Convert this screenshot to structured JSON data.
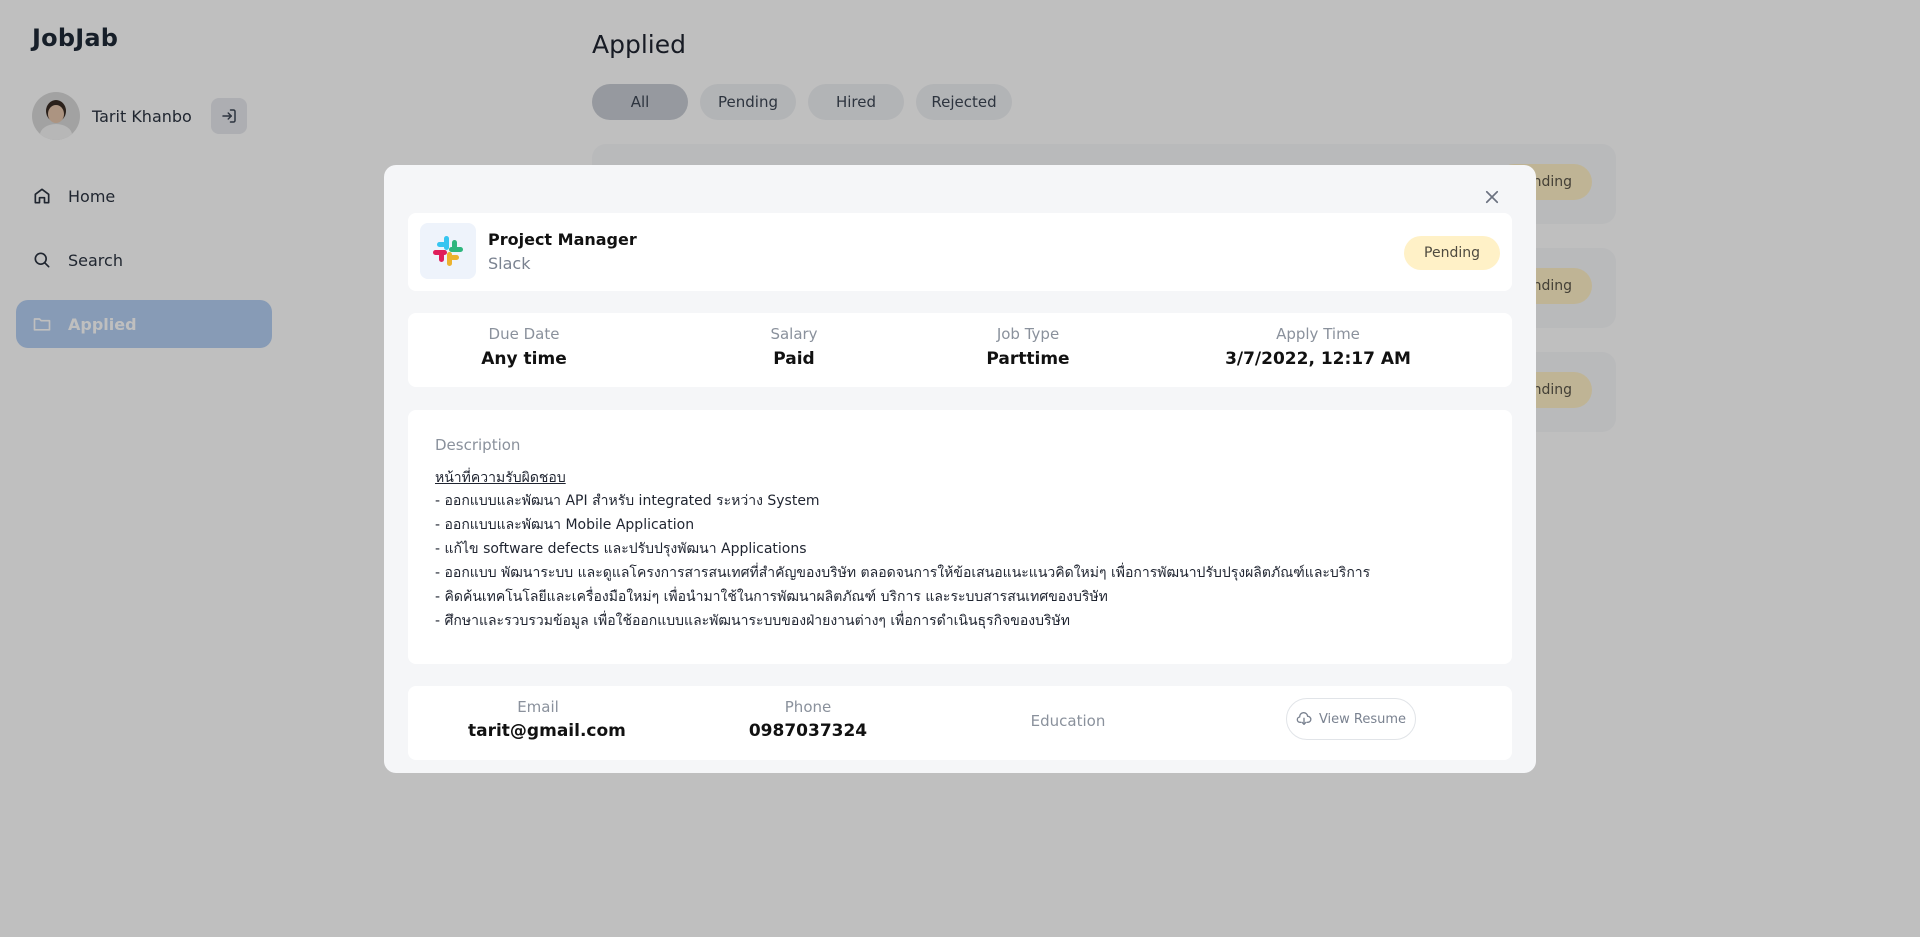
{
  "app": {
    "brand": "JobJab"
  },
  "user": {
    "name": "Tarit Khanbo"
  },
  "nav": [
    {
      "label": "Home",
      "icon": "home-icon"
    },
    {
      "label": "Search",
      "icon": "search-icon"
    },
    {
      "label": "Applied",
      "icon": "folder-icon",
      "active": true
    }
  ],
  "page": {
    "title": "Applied",
    "filters": [
      {
        "label": "All",
        "active": true
      },
      {
        "label": "Pending"
      },
      {
        "label": "Hired"
      },
      {
        "label": "Rejected"
      }
    ],
    "cards": [
      {
        "status": "Pending"
      },
      {
        "status": "Pending"
      },
      {
        "status": "Pending"
      }
    ]
  },
  "modal": {
    "job_title": "Project Manager",
    "company": "Slack",
    "status": "Pending",
    "meta": {
      "due_date_label": "Due Date",
      "due_date": "Any time",
      "salary_label": "Salary",
      "salary": "Paid",
      "job_type_label": "Job Type",
      "job_type": "Parttime",
      "apply_time_label": "Apply Time",
      "apply_time": "3/7/2022, 12:17 AM"
    },
    "description": {
      "label": "Description",
      "heading": "หน้าที่ความรับผิดชอบ",
      "lines": [
        "- ออกแบบและพัฒนา API สำหรับ integrated ระหว่าง System",
        "- ออกแบบและพัฒนา Mobile Application",
        "- แก้ไข software defects และปรับปรุงพัฒนา Applications",
        "- ออกแบบ พัฒนาระบบ และดูแลโครงการสารสนเทศที่สำคัญของบริษัท ตลอดจนการให้ข้อเสนอแนะแนวคิดใหม่ๆ เพื่อการพัฒนาปรับปรุงผลิตภัณฑ์และบริการ",
        "- คิดค้นเทคโนโลยีและเครื่องมือใหม่ๆ เพื่อนำมาใช้ในการพัฒนาผลิตภัณฑ์ บริการ และระบบสารสนเทศของบริษัท",
        "- ศึกษาและรวบรวมข้อมูล เพื่อใช้ออกแบบและพัฒนาระบบของฝ่ายงานต่างๆ เพื่อการดำเนินธุรกิจของบริษัท"
      ]
    },
    "contact": {
      "email_label": "Email",
      "email": "tarit@gmail.com",
      "phone_label": "Phone",
      "phone": "0987037324",
      "education_label": "Education",
      "resume_button": "View Resume"
    }
  }
}
